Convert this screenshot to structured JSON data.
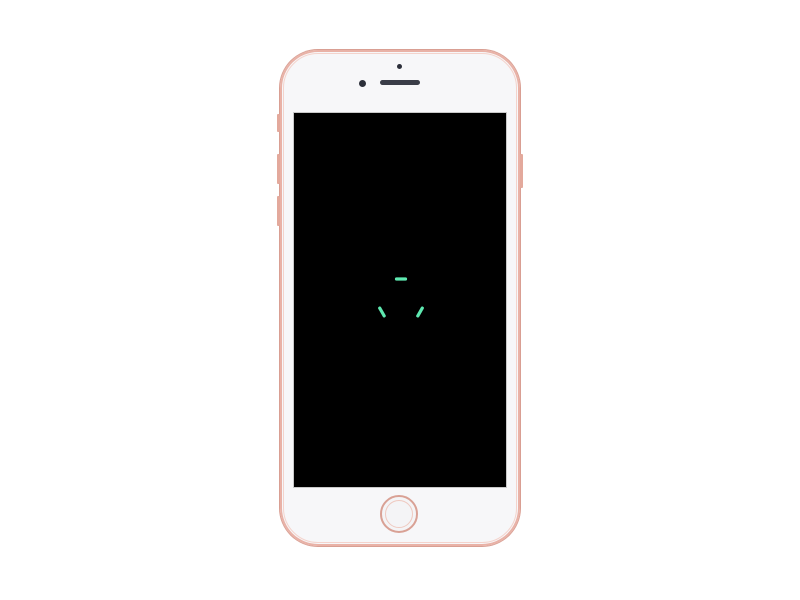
{
  "device": {
    "model": "phone",
    "body_color": "#f7f7f9",
    "trim_color": "#e9b2a7",
    "screen_color": "#000000"
  },
  "screen": {
    "state": "loading",
    "spinner": {
      "icon": "loading-spinner-icon",
      "color": "#5ee8b0",
      "segments": 3
    }
  }
}
